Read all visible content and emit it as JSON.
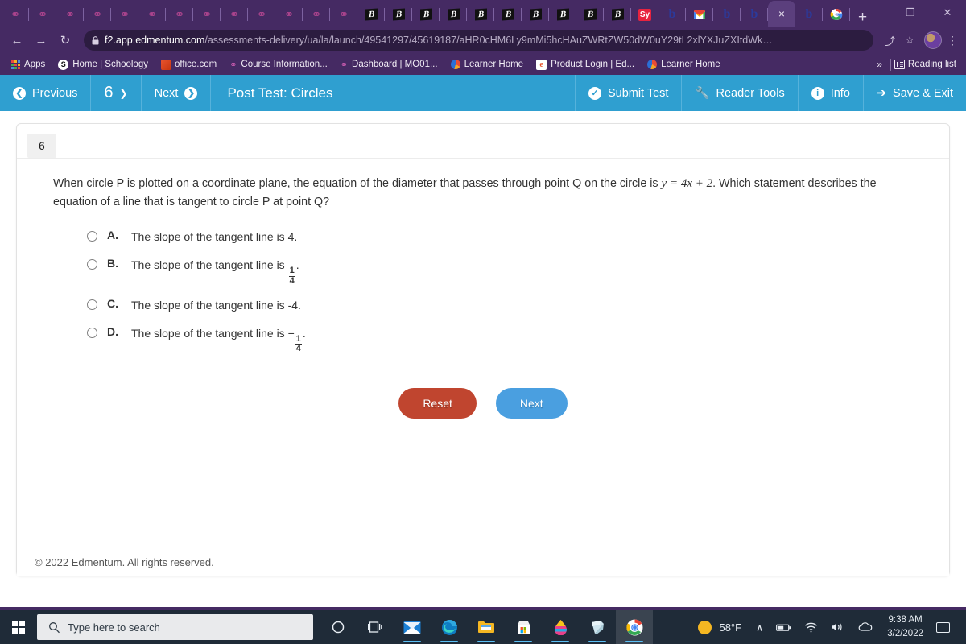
{
  "browser": {
    "pinned_tabs": [
      {
        "icon": "pin-icon"
      },
      {
        "icon": "pin-icon"
      },
      {
        "icon": "pin-icon"
      },
      {
        "icon": "pin-icon"
      },
      {
        "icon": "pin-icon"
      },
      {
        "icon": "pin-icon"
      },
      {
        "icon": "pin-icon"
      },
      {
        "icon": "pin-icon"
      },
      {
        "icon": "pin-icon"
      },
      {
        "icon": "pin-icon"
      },
      {
        "icon": "pin-icon"
      },
      {
        "icon": "pin-icon"
      },
      {
        "icon": "pin-icon"
      }
    ],
    "tabs": [
      {
        "icon": "bold-b-icon"
      },
      {
        "icon": "bold-b-icon"
      },
      {
        "icon": "bold-b-icon"
      },
      {
        "icon": "bold-b-icon"
      },
      {
        "icon": "bold-b-icon"
      },
      {
        "icon": "bold-b-icon"
      },
      {
        "icon": "bold-b-icon"
      },
      {
        "icon": "bold-b-icon"
      },
      {
        "icon": "bold-b-icon"
      },
      {
        "icon": "bold-b-icon"
      },
      {
        "icon": "sy-icon",
        "label": "Sy"
      },
      {
        "icon": "b-blue-icon",
        "label": "b"
      },
      {
        "icon": "gmail-icon"
      },
      {
        "icon": "b-blue-icon",
        "label": "b"
      },
      {
        "icon": "b-blue-icon",
        "label": "b"
      },
      {
        "icon": "close-icon",
        "label": "×",
        "active": true
      },
      {
        "icon": "b-blue-icon",
        "label": "b"
      },
      {
        "icon": "google-icon"
      }
    ],
    "new_tab_label": "+",
    "window_controls": [
      {
        "name": "tab-search-icon",
        "glyph": "⌄"
      },
      {
        "name": "minimize-icon",
        "glyph": "—"
      },
      {
        "name": "restore-icon",
        "glyph": "❐"
      },
      {
        "name": "close-window-icon",
        "glyph": "✕"
      }
    ],
    "nav": {
      "back_glyph": "←",
      "forward_glyph": "→",
      "reload_glyph": "↻"
    },
    "omnibox": {
      "lock_glyph": "🔒",
      "domain": "f2.app.edmentum.com",
      "path": "/assessments-delivery/ua/la/launch/49541297/45619187/aHR0cHM6Ly9mMi5hcHAuZWRtZW50dW0uY29tL2xlYXJuZXItdWk…",
      "share_glyph": "⤴",
      "bookmark_glyph": "☆"
    },
    "menu_glyph": "⋮",
    "bookmarks": [
      {
        "label": "Apps",
        "icon": "apps-grid-icon"
      },
      {
        "label": "Home | Schoology",
        "icon": "schoology-icon"
      },
      {
        "label": "office.com",
        "icon": "office-icon"
      },
      {
        "label": "Course Information...",
        "icon": "pin-icon"
      },
      {
        "label": "Dashboard | MO01...",
        "icon": "pin-icon"
      },
      {
        "label": "Learner Home",
        "icon": "edmentum-icon"
      },
      {
        "label": "Product Login | Ed...",
        "icon": "edmentum-e-icon"
      },
      {
        "label": "Learner Home",
        "icon": "edmentum-icon"
      }
    ],
    "bookmarks_overflow": "»",
    "reading_list": "Reading list"
  },
  "app_toolbar": {
    "previous_label": "Previous",
    "previous_icon": "arrow-left-circle-icon",
    "question_number": "6",
    "question_caret": "⌄",
    "next_label": "Next",
    "next_icon": "arrow-right-circle-icon",
    "title": "Post Test: Circles",
    "submit_label": "Submit Test",
    "submit_icon": "check-circle-icon",
    "reader_label": "Reader Tools",
    "reader_icon": "wrench-icon",
    "info_label": "Info",
    "info_icon": "info-circle-icon",
    "save_exit_label": "Save & Exit",
    "save_exit_icon": "exit-icon",
    "accent_color": "#2f9fd0"
  },
  "question": {
    "badge": "6",
    "text_part1": "When circle P is plotted on a coordinate plane, the equation of the diameter that passes through point Q on the circle is ",
    "equation": "y = 4x + 2",
    "text_part2": ". Which statement describes the equation of a line that is tangent to circle P at point Q?",
    "options": [
      {
        "letter": "A.",
        "text": "The slope of the tangent line is 4.",
        "selected": false,
        "fraction": null,
        "prefix": null,
        "suffix": null
      },
      {
        "letter": "B.",
        "text": "The slope of the tangent line is ",
        "selected": false,
        "fraction": {
          "numerator": "1",
          "denominator": "4"
        },
        "prefix": "",
        "suffix": "."
      },
      {
        "letter": "C.",
        "text": "The slope of the tangent line is -4.",
        "selected": false,
        "fraction": null,
        "prefix": null,
        "suffix": null
      },
      {
        "letter": "D.",
        "text": "The slope of the tangent line is ",
        "selected": false,
        "fraction": {
          "numerator": "1",
          "denominator": "4"
        },
        "prefix": "−",
        "suffix": "."
      }
    ]
  },
  "buttons": {
    "reset_label": "Reset",
    "reset_color": "#c0452f",
    "next_label": "Next",
    "next_color": "#4a9fe0"
  },
  "footer": {
    "copyright": "© 2022 Edmentum. All rights reserved."
  },
  "taskbar": {
    "start_icon": "windows-start-icon",
    "search_placeholder": "Type here to search",
    "search_icon": "search-icon",
    "items": [
      {
        "name": "cortana-icon"
      },
      {
        "name": "task-view-icon"
      },
      {
        "name": "mail-icon"
      },
      {
        "name": "edge-icon"
      },
      {
        "name": "file-explorer-icon"
      },
      {
        "name": "microsoft-store-icon"
      },
      {
        "name": "paint-3d-icon"
      },
      {
        "name": "sticky-notes-icon"
      },
      {
        "name": "chrome-icon"
      }
    ],
    "weather_temp": "58°F",
    "tray_chevron": "∧",
    "battery_icon": "battery-icon",
    "wifi_icon": "wifi-icon",
    "volume_icon": "volume-icon",
    "onedrive_icon": "onedrive-icon",
    "time": "9:38 AM",
    "date": "3/2/2022",
    "action_center_icon": "action-center-icon"
  }
}
